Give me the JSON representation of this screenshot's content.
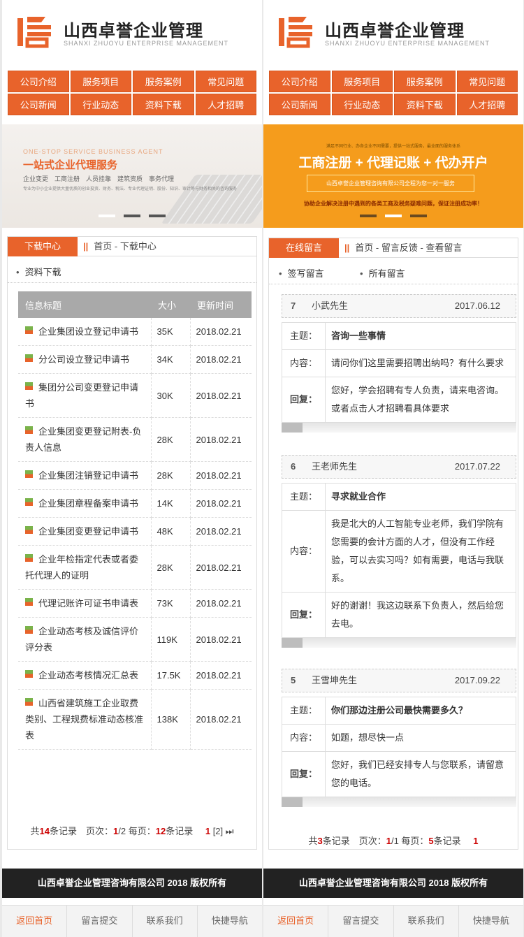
{
  "site": {
    "title": "山西卓誉企业管理",
    "subtitle": "SHANXI ZHUOYU ENTERPRISE MANAGEMENT"
  },
  "nav": [
    "公司介绍",
    "服务项目",
    "服务案例",
    "常见问题",
    "公司新闻",
    "行业动态",
    "资料下载",
    "人才招聘"
  ],
  "banner_left": {
    "en": "ONE-STOP SERVICE BUSINESS AGENT",
    "cn": "一站式企业代理服务",
    "line1": "企业变更　工商注册　人员挂靠　建筑资质　事务代理",
    "line2": "专业为中小企业提供大量优质的创业投资、财务、税法、专业代理证明、股份、知识、审计等与财务相关的咨询服务"
  },
  "banner_right": {
    "top": "满足不同行业、办各企业不同需要，提供一站式服务，最全面的服务体系",
    "big": "工商注册 + 代理记账 + 代办开户",
    "pill": "山西卓誉企业管理咨询有限公司全程为您一对一服务",
    "bottom": "协助企业解决注册中遇到的各类工商及税务疑难问题，保证注册成功率！"
  },
  "left": {
    "section_tab": "下载中心",
    "crumb": "首页 - 下载中心",
    "sub_link": "资料下载",
    "table_headers": [
      "信息标题",
      "大小",
      "更新时间"
    ],
    "rows": [
      {
        "title": "企业集团设立登记申请书",
        "size": "35K",
        "date": "2018.02.21"
      },
      {
        "title": "分公司设立登记申请书",
        "size": "34K",
        "date": "2018.02.21"
      },
      {
        "title": "集团分公司变更登记申请书",
        "size": "30K",
        "date": "2018.02.21"
      },
      {
        "title": "企业集团变更登记附表-负责人信息",
        "size": "28K",
        "date": "2018.02.21"
      },
      {
        "title": "企业集团注销登记申请书",
        "size": "28K",
        "date": "2018.02.21"
      },
      {
        "title": "企业集团章程备案申请书",
        "size": "14K",
        "date": "2018.02.21"
      },
      {
        "title": "企业集团变更登记申请书",
        "size": "48K",
        "date": "2018.02.21"
      },
      {
        "title": "企业年检指定代表或者委托代理人的证明",
        "size": "28K",
        "date": "2018.02.21"
      },
      {
        "title": "代理记账许可证书申请表",
        "size": "73K",
        "date": "2018.02.21"
      },
      {
        "title": "企业动态考核及诚信评价评分表",
        "size": "119K",
        "date": "2018.02.21"
      },
      {
        "title": "企业动态考核情况汇总表",
        "size": "17.5K",
        "date": "2018.02.21"
      },
      {
        "title": "山西省建筑施工企业取费类别、工程规费标准动态核准表",
        "size": "138K",
        "date": "2018.02.21"
      }
    ],
    "pager": {
      "p1": "共",
      "total": "14",
      "p2": "条记录　页次：",
      "page": "1",
      "p3": "/2 每页：",
      "per": "12",
      "p4": "条记录",
      "link1": "1",
      "link2": "[2]",
      "last": "⏭"
    }
  },
  "right": {
    "section_tab": "在线留言",
    "crumb": "首页 - 留言反馈 - 查看留言",
    "sub_links": [
      "签写留言",
      "所有留言"
    ],
    "labels": {
      "subject": "主题：",
      "content": "内容：",
      "reply": "回复："
    },
    "messages": [
      {
        "num": "7",
        "name": "小武先生",
        "date": "2017.06.12",
        "subject": "咨询一些事情",
        "content": "请问你们这里需要招聘出纳吗？有什么要求",
        "reply": "您好，学会招聘有专人负责，请来电咨询。或者点击人才招聘看具体要求"
      },
      {
        "num": "6",
        "name": "王老师先生",
        "date": "2017.07.22",
        "subject": "寻求就业合作",
        "content": "我是北大的人工智能专业老师，我们学院有您需要的会计方面的人才，但没有工作经验，可以去实习吗？如有需要，电话与我联系。",
        "reply": "好的谢谢！我这边联系下负责人，然后给您去电。"
      },
      {
        "num": "5",
        "name": "王雪坤先生",
        "date": "2017.09.22",
        "subject": "你们那边注册公司最快需要多久？",
        "content": "如题，想尽快一点",
        "reply": "您好，我们已经安排专人与您联系，请留意您的电话。"
      }
    ],
    "pager": {
      "p1": "共",
      "total": "3",
      "p2": "条记录　页次：",
      "page": "1",
      "p3": "/1 每页：",
      "per": "5",
      "p4": "条记录",
      "link1": "1"
    }
  },
  "footer": "山西卓誉企业管理咨询有限公司  2018  版权所有",
  "bottom_nav": [
    "返回首页",
    "留言提交",
    "联系我们",
    "快捷导航"
  ],
  "colors": {
    "accent": "#e8632b",
    "banner_orange": "#f59c1c",
    "footer": "#222222"
  }
}
